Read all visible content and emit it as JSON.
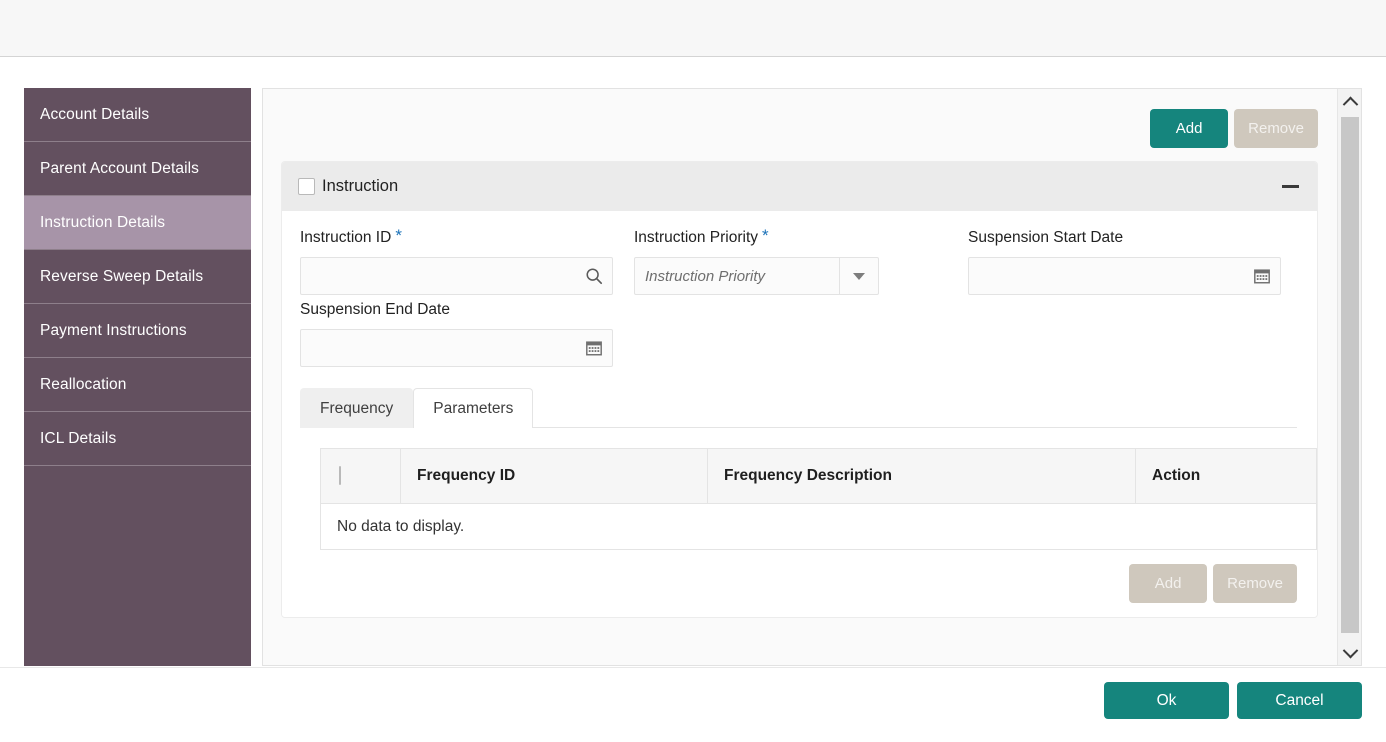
{
  "sidebar": {
    "items": [
      {
        "label": "Account Details",
        "active": false
      },
      {
        "label": "Parent Account Details",
        "active": false
      },
      {
        "label": "Instruction Details",
        "active": true
      },
      {
        "label": "Reverse Sweep Details",
        "active": false
      },
      {
        "label": "Payment Instructions",
        "active": false
      },
      {
        "label": "Reallocation",
        "active": false
      },
      {
        "label": "ICL Details",
        "active": false
      }
    ]
  },
  "toolbar": {
    "add_label": "Add",
    "remove_label": "Remove"
  },
  "instruction": {
    "title": "Instruction",
    "checkbox_checked": false,
    "collapse_icon": "minus-icon",
    "fields": {
      "instruction_id": {
        "label": "Instruction ID",
        "required": true,
        "value": "",
        "placeholder": "",
        "icon": "search-icon"
      },
      "instruction_priority": {
        "label": "Instruction Priority",
        "required": true,
        "value": "",
        "placeholder": "Instruction Priority",
        "icon": "chevron-down-icon"
      },
      "suspension_start_date": {
        "label": "Suspension Start Date",
        "required": false,
        "value": "",
        "placeholder": "",
        "icon": "calendar-icon"
      },
      "suspension_end_date": {
        "label": "Suspension End Date",
        "required": false,
        "value": "",
        "placeholder": "",
        "icon": "calendar-icon"
      }
    }
  },
  "tabs": [
    {
      "label": "Frequency",
      "active": true
    },
    {
      "label": "Parameters",
      "active": false
    }
  ],
  "table": {
    "columns": [
      "",
      "Frequency ID",
      "Frequency Description",
      "Action"
    ],
    "rows": [],
    "empty_message": "No data to display.",
    "add_label": "Add",
    "remove_label": "Remove"
  },
  "scrollbar": {
    "up_icon": "chevron-up-icon",
    "down_icon": "chevron-down-icon"
  },
  "footer": {
    "ok_label": "Ok",
    "cancel_label": "Cancel"
  },
  "colors": {
    "accent_teal": "#15857d",
    "sidebar_purple": "#63505f",
    "sidebar_active": "#a794a8",
    "disabled_beige": "#cfc8bd",
    "required_blue": "#1b72b8"
  }
}
